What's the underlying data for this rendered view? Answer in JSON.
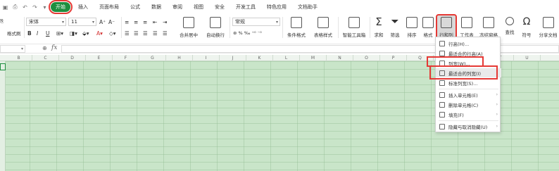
{
  "colors": {
    "accent": "#1e8e3e",
    "highlight": "#e53935",
    "sheet": "#c9e5c9"
  },
  "quick_icons": [
    "save-icon",
    "print-icon",
    "undo-icon",
    "redo-icon",
    "more-icon"
  ],
  "menu_tabs": [
    "开始",
    "插入",
    "页面布局",
    "公式",
    "数据",
    "审阅",
    "视图",
    "安全",
    "开发工具",
    "特色应用",
    "文档助手"
  ],
  "ribbon": {
    "format_painter": "格式刷",
    "font_name": "宋体",
    "font_size": "11",
    "bold": "B",
    "italic": "I",
    "underline": "U",
    "merge_center": "合并居中",
    "auto_wrap": "自动换行",
    "number_format": "常规",
    "conditional_format": "条件格式",
    "table_style": "表格样式",
    "smart_toolbox": "智能工具箱",
    "sum": "求和",
    "filter": "筛选",
    "sort": "排序",
    "format": "格式",
    "row_col": "行和列",
    "worksheet": "工作表",
    "freeze": "冻结窗格",
    "find": "查找",
    "symbol": "符号",
    "share": "分享文档"
  },
  "formula": {
    "fx": "fx"
  },
  "columns": [
    "B",
    "C",
    "D",
    "E",
    "F",
    "G",
    "H",
    "I",
    "J",
    "K",
    "L",
    "M",
    "N",
    "O",
    "P",
    "Q",
    "R",
    "S",
    "T",
    "U"
  ],
  "dropdown": {
    "items": [
      {
        "label": "行高(H)...",
        "icon": "row-height-icon"
      },
      {
        "label": "最适合的行高(A)",
        "icon": "fit-row-height-icon"
      },
      {
        "label": "列宽(W)...",
        "icon": "column-width-icon"
      },
      {
        "label": "最适合的列宽(I)",
        "icon": "fit-column-width-icon"
      },
      {
        "label": "标准列宽(S)...",
        "icon": "standard-width-icon"
      },
      {
        "label": "插入单元格(E)",
        "icon": "insert-cell-icon"
      },
      {
        "label": "删除单元格(C)",
        "icon": "delete-cell-icon"
      },
      {
        "label": "填充(F)",
        "icon": "fill-icon"
      },
      {
        "label": "隐藏与取消隐藏(U)",
        "icon": "hide-unhide-icon"
      }
    ]
  }
}
